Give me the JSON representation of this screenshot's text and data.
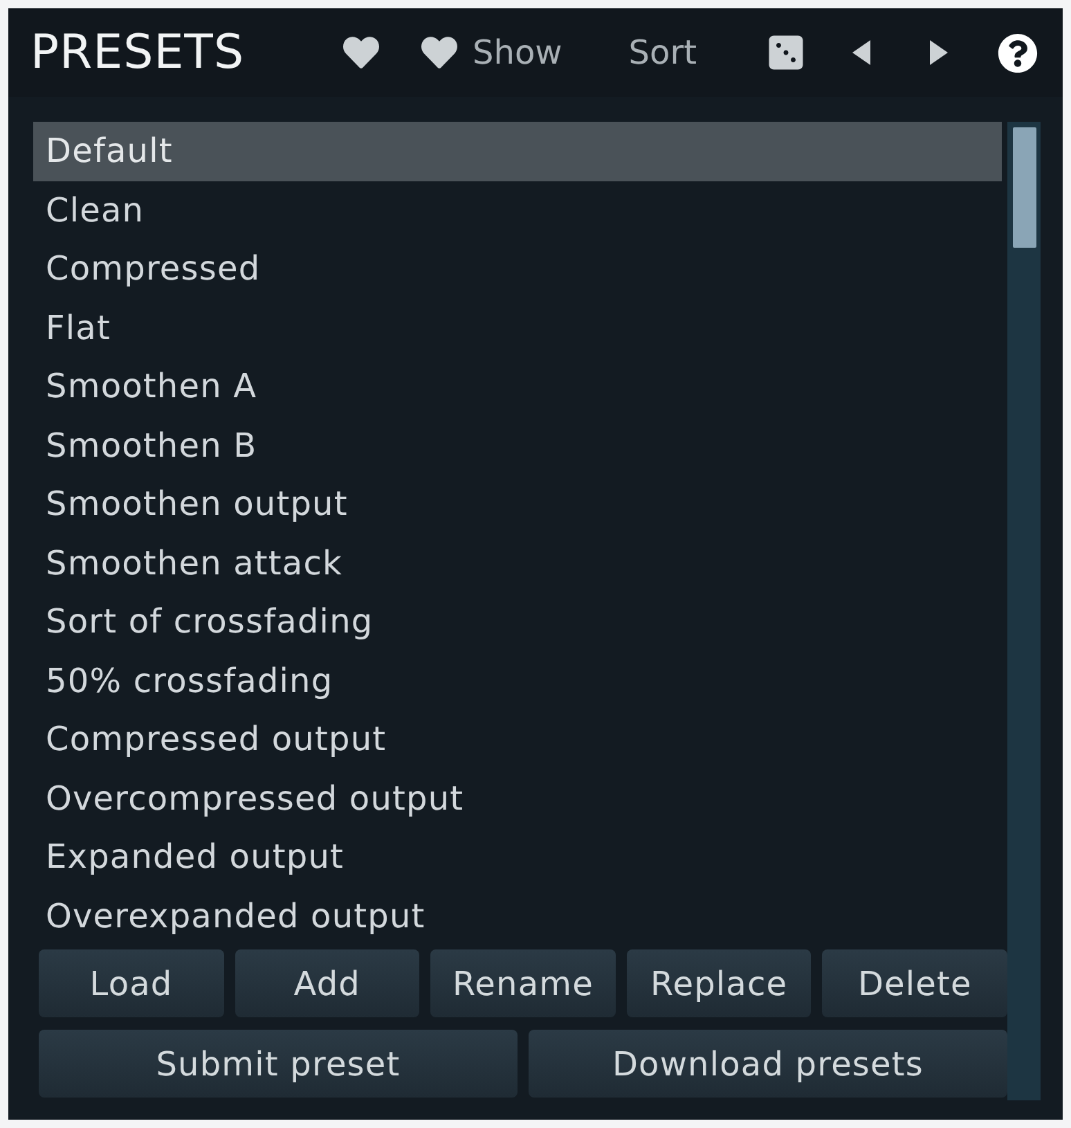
{
  "header": {
    "title": "PRESETS",
    "show_button": "Show",
    "sort_button": "Sort"
  },
  "presets": [
    {
      "name": "Default",
      "selected": true
    },
    {
      "name": "Clean",
      "selected": false
    },
    {
      "name": "Compressed",
      "selected": false
    },
    {
      "name": "Flat",
      "selected": false
    },
    {
      "name": "Smoothen A",
      "selected": false
    },
    {
      "name": "Smoothen B",
      "selected": false
    },
    {
      "name": "Smoothen output",
      "selected": false
    },
    {
      "name": "Smoothen attack",
      "selected": false
    },
    {
      "name": "Sort of crossfading",
      "selected": false
    },
    {
      "name": "50% crossfading",
      "selected": false
    },
    {
      "name": "Compressed output",
      "selected": false
    },
    {
      "name": "Overcompressed output",
      "selected": false
    },
    {
      "name": "Expanded output",
      "selected": false
    },
    {
      "name": "Overexpanded output",
      "selected": false
    }
  ],
  "buttons": [
    "Load",
    "Add",
    "Rename",
    "Replace",
    "Delete"
  ],
  "wide_buttons": [
    "Submit preset",
    "Download presets"
  ]
}
